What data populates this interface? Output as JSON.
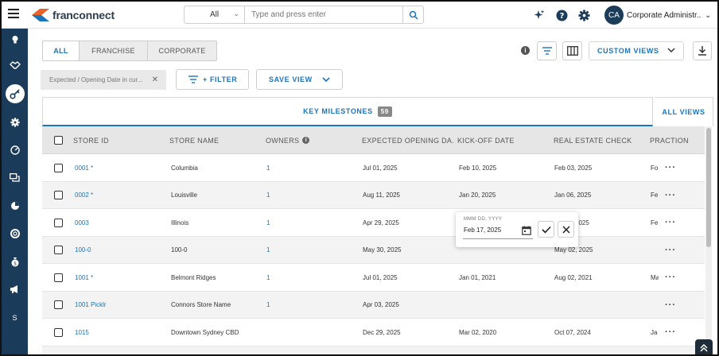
{
  "app": {
    "logo_text": "franconnect"
  },
  "search": {
    "scope": "All",
    "placeholder": "Type and press enter"
  },
  "user": {
    "initials": "CA",
    "name": "Corporate Administr..."
  },
  "sidebar": {
    "items": [
      {
        "icon": "lightbulb-icon"
      },
      {
        "icon": "handshake-icon"
      },
      {
        "icon": "key-icon",
        "active": true
      },
      {
        "icon": "gear-icon"
      },
      {
        "icon": "gauge-icon"
      },
      {
        "icon": "chat-icon"
      },
      {
        "icon": "chart-icon"
      },
      {
        "icon": "support-icon"
      },
      {
        "icon": "moneybag-icon"
      },
      {
        "icon": "megaphone-icon"
      },
      {
        "icon": "dollar-icon",
        "label": "S"
      }
    ]
  },
  "segment": {
    "all": "ALL",
    "franchise": "FRANCHISE",
    "corporate": "CORPORATE"
  },
  "toolbar": {
    "custom_views": "CUSTOM VIEWS",
    "filter_chip": "Expected / Opening Date in cur...",
    "filter_btn": "+ FILTER",
    "save_view": "SAVE VIEW"
  },
  "tabs": {
    "key_milestones": "KEY MILESTONES",
    "count": "59",
    "all_views": "ALL VIEWS"
  },
  "table": {
    "columns": {
      "store_id": "STORE ID",
      "store_name": "STORE NAME",
      "owners": "OWNERS",
      "expected_opening": "EXPECTED OPENING DA...",
      "kickoff": "KICK-OFF DATE",
      "real_estate": "REAL ESTATE CHECK",
      "pr": "PR",
      "action": "ACTION"
    },
    "rows": [
      {
        "store_id": "0001 *",
        "store_name": "Columbia",
        "owners": "1",
        "expected": "Jul 01, 2025",
        "kickoff": "Feb 10, 2025",
        "real_estate": "Feb 03, 2025",
        "pr": "Fo"
      },
      {
        "store_id": "0002 *",
        "store_name": "Louisville",
        "owners": "1",
        "expected": "Aug 11, 2025",
        "kickoff": "Jan 20, 2025",
        "real_estate": "Jan 06, 2025",
        "pr": "Fe"
      },
      {
        "store_id": "0003",
        "store_name": "Illinois",
        "owners": "1",
        "expected": "Apr 29, 2025",
        "kickoff": "",
        "real_estate": "2025",
        "pr": "Fe"
      },
      {
        "store_id": "100-0",
        "store_name": "100-0",
        "owners": "1",
        "expected": "May 30, 2025",
        "kickoff": "",
        "real_estate": "May 02, 2025",
        "pr": ""
      },
      {
        "store_id": "1001 *",
        "store_name": "Belmont Ridges",
        "owners": "1",
        "expected": "Jul 01, 2025",
        "kickoff": "Jan 01, 2021",
        "real_estate": "Aug 02, 2021",
        "pr": "Ma"
      },
      {
        "store_id": "1001 Picklr",
        "store_name": "Connors Store Name",
        "owners": "1",
        "expected": "Apr 03, 2025",
        "kickoff": "",
        "real_estate": "",
        "pr": ""
      },
      {
        "store_id": "1015",
        "store_name": "Downtown Sydney CBD",
        "owners": "",
        "expected": "Dec 29, 2025",
        "kickoff": "Mar 02, 2020",
        "real_estate": "Oct 07, 2024",
        "pr": "Ja"
      }
    ]
  },
  "date_popup": {
    "label": "MMM DD, YYYY",
    "value": "Feb 17, 2025"
  },
  "colors": {
    "sidebar": "#1a3c5a",
    "accent": "#1b75bb"
  }
}
